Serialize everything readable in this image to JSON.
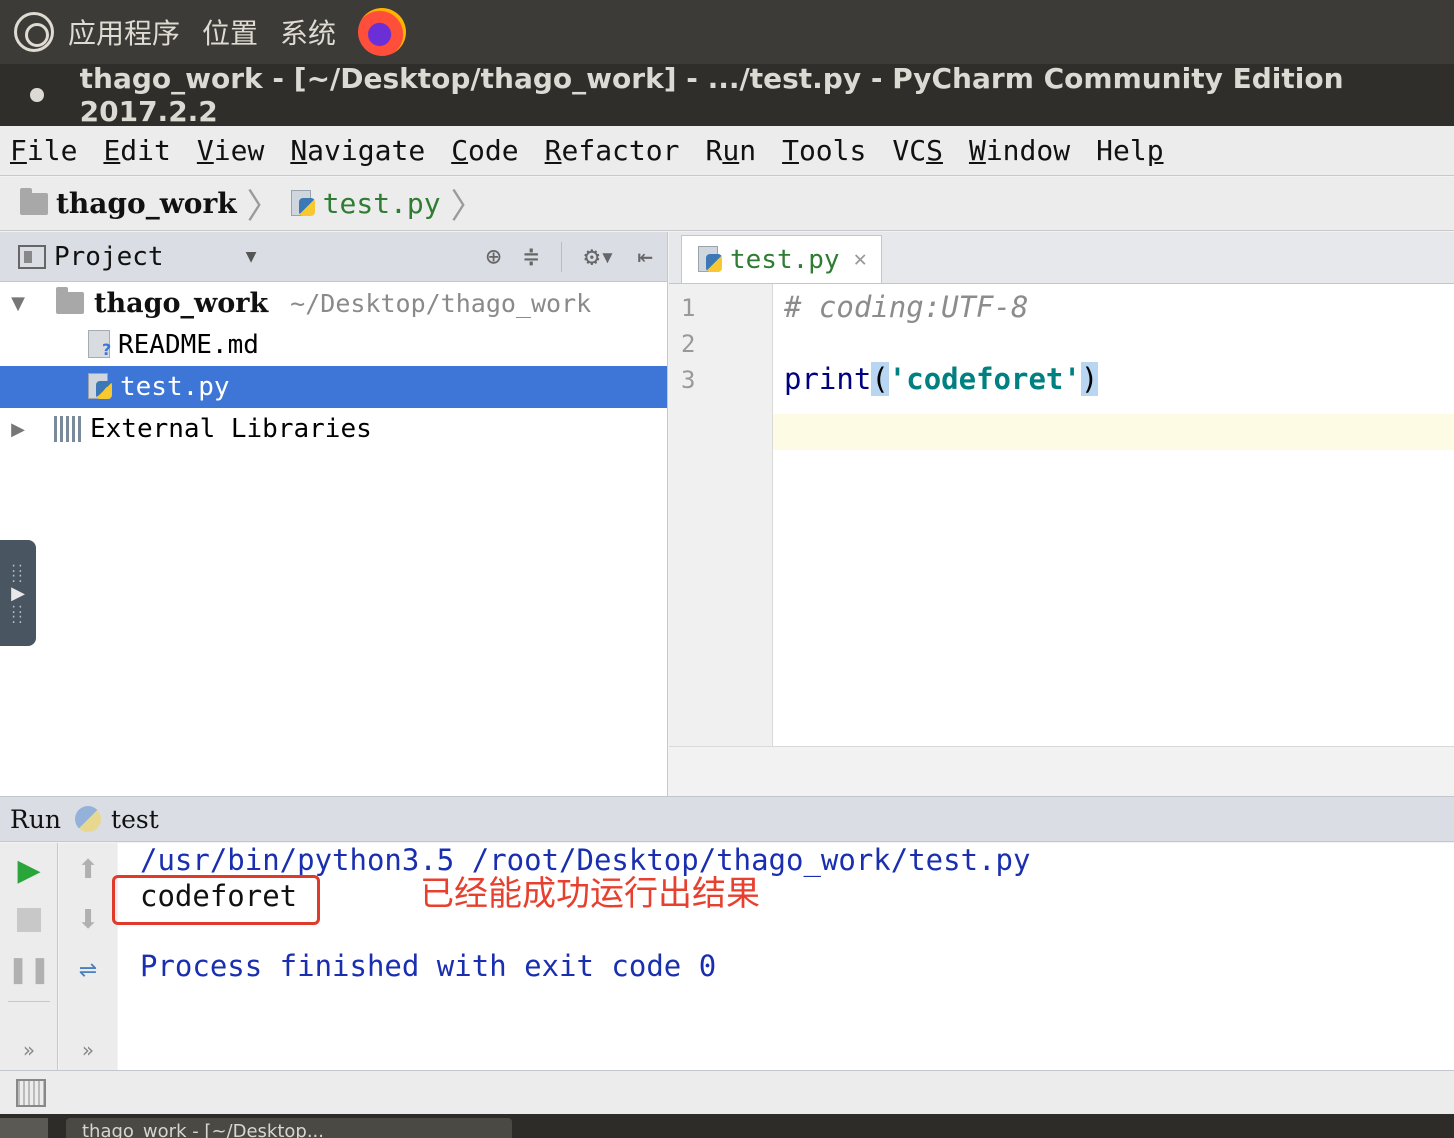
{
  "top_panel": {
    "menus": [
      "应用程序",
      "位置",
      "系统"
    ]
  },
  "window": {
    "title": "thago_work - [~/Desktop/thago_work] - .../test.py - PyCharm Community Edition 2017.2.2"
  },
  "menu_bar": {
    "items": [
      {
        "mnemonic": "F",
        "rest": "ile"
      },
      {
        "mnemonic": "E",
        "rest": "dit"
      },
      {
        "mnemonic": "V",
        "rest": "iew"
      },
      {
        "mnemonic": "N",
        "rest": "avigate"
      },
      {
        "mnemonic": "C",
        "rest": "ode"
      },
      {
        "mnemonic": "R",
        "rest": "efactor"
      },
      {
        "pre": "R",
        "mnemonic": "u",
        "rest": "n"
      },
      {
        "mnemonic": "T",
        "rest": "ools"
      },
      {
        "pre": "VC",
        "mnemonic": "S",
        "rest": ""
      },
      {
        "mnemonic": "W",
        "rest": "indow"
      },
      {
        "pre": "Hel",
        "mnemonic": "p",
        "rest": ""
      }
    ]
  },
  "breadcrumb": {
    "project": "thago_work",
    "file": "test.py"
  },
  "project_panel": {
    "title": "Project",
    "tree": {
      "root_name": "thago_work",
      "root_path": "~/Desktop/thago_work",
      "readme": "README.md",
      "test_file": "test.py",
      "libraries": "External Libraries"
    }
  },
  "editor": {
    "tab_label": "test.py",
    "line_numbers": [
      "1",
      "2",
      "3"
    ],
    "line1_comment": "# coding:UTF-8",
    "line3": {
      "func": "print",
      "open": "(",
      "string": "'codeforet'",
      "close": ")"
    }
  },
  "run_panel": {
    "label": "Run",
    "config": "test",
    "command": "/usr/bin/python3.5 /root/Desktop/thago_work/test.py",
    "output": "codeforet",
    "exit_message": "Process finished with exit code 0",
    "more": "»"
  },
  "annotation": {
    "text": "已经能成功运行出结果",
    "color": "#e8402e"
  },
  "taskbar": {
    "item": "thago_work - [~/Desktop..."
  }
}
